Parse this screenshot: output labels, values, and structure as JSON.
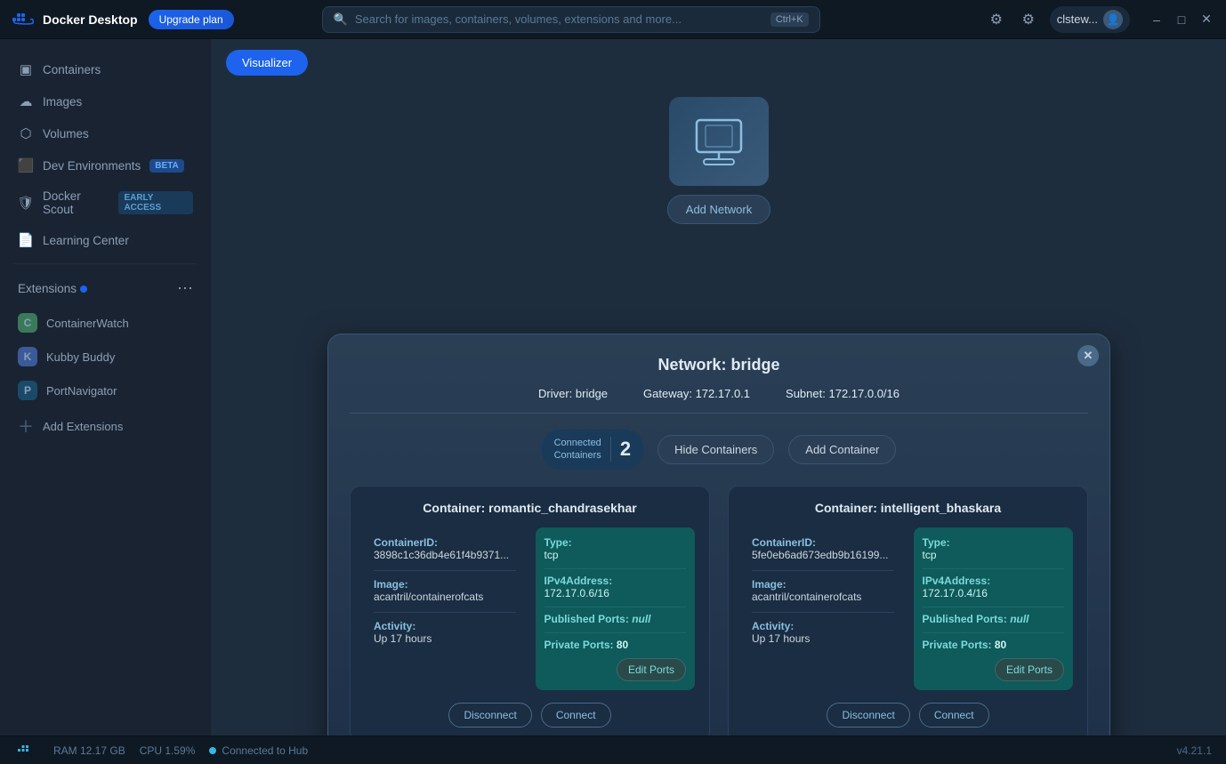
{
  "titlebar": {
    "app_name": "Docker Desktop",
    "upgrade_label": "Upgrade plan",
    "search_placeholder": "Search for images, containers, volumes, extensions and more...",
    "shortcut": "Ctrl+K",
    "user": "clstew...",
    "minimize": "–",
    "maximize": "□",
    "close": "✕"
  },
  "sidebar": {
    "items": [
      {
        "label": "Containers",
        "icon": "▣"
      },
      {
        "label": "Images",
        "icon": "☁"
      },
      {
        "label": "Volumes",
        "icon": "⬡"
      },
      {
        "label": "Dev Environments",
        "icon": "⬛",
        "badge": "BETA"
      },
      {
        "label": "Docker Scout",
        "icon": "🛡",
        "badge": "EARLY ACCESS"
      },
      {
        "label": "Learning Center",
        "icon": "📄"
      }
    ],
    "extensions_label": "Extensions",
    "extensions": [
      {
        "label": "ContainerWatch",
        "color": "#3a7a5a"
      },
      {
        "label": "Kubby Buddy",
        "color": "#3a5a9a"
      },
      {
        "label": "PortNavigator",
        "color": "#1a4a6a"
      }
    ],
    "add_extensions_label": "Add Extensions"
  },
  "tabs": [
    {
      "label": "Visualizer"
    }
  ],
  "network_node": {
    "add_network_label": "Add Network"
  },
  "bridge_panel": {
    "title": "Network: bridge",
    "driver_label": "Driver:",
    "driver_value": "bridge",
    "gateway_label": "Gateway:",
    "gateway_value": "172.17.0.1",
    "subnet_label": "Subnet:",
    "subnet_value": "172.17.0.0/16",
    "connected_containers_label": "Connected\nContainers",
    "connected_count": "2",
    "hide_containers_label": "Hide Containers",
    "add_container_label": "Add Container",
    "close_label": "✕"
  },
  "containers": [
    {
      "title": "Container: romantic_chandrasekhar",
      "container_id_label": "ContainerID:",
      "container_id": "3898c1c36db4e61f4b9371...",
      "image_label": "Image:",
      "image": "acantril/containerofcats",
      "activity_label": "Activity:",
      "activity": "Up 17 hours",
      "type_label": "Type:",
      "type": "tcp",
      "ipv4_label": "IPv4Address:",
      "ipv4": "172.17.0.6/16",
      "published_label": "Published Ports:",
      "published": "null",
      "private_label": "Private Ports:",
      "private": "80",
      "edit_ports_label": "Edit Ports",
      "disconnect_label": "Disconnect",
      "connect_label": "Connect"
    },
    {
      "title": "Container: intelligent_bhaskara",
      "container_id_label": "ContainerID:",
      "container_id": "5fe0eb6ad673edb9b16199...",
      "image_label": "Image:",
      "image": "acantril/containerofcats",
      "activity_label": "Activity:",
      "activity": "Up 17 hours",
      "type_label": "Type:",
      "type": "tcp",
      "ipv4_label": "IPv4Address:",
      "ipv4": "172.17.0.4/16",
      "published_label": "Published Ports:",
      "published": "null",
      "private_label": "Private Ports:",
      "private": "80",
      "edit_ports_label": "Edit Ports",
      "disconnect_label": "Disconnect",
      "connect_label": "Connect"
    }
  ],
  "statusbar": {
    "ram": "RAM 12.17 GB",
    "cpu": "CPU 1.59%",
    "connected": "Connected to Hub",
    "version": "v4.21.1"
  }
}
